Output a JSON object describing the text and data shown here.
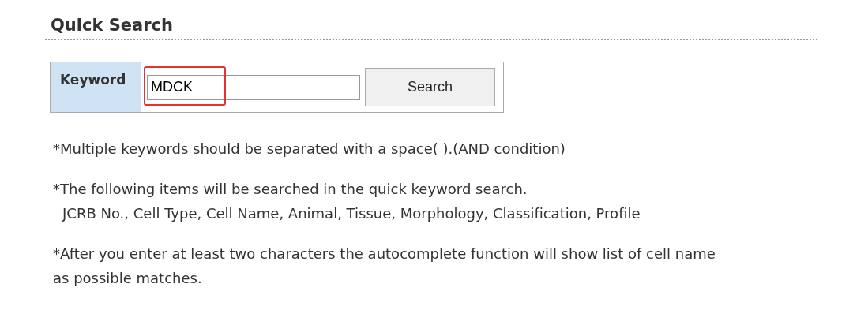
{
  "title": "Quick Search",
  "search": {
    "label": "Keyword",
    "value": "MDCK",
    "highlighted": true,
    "button": "Search"
  },
  "notes": [
    {
      "lines": [
        "*Multiple keywords should be separated with a space( ).(AND condition)"
      ]
    },
    {
      "lines": [
        "*The following items will be searched in the quick keyword search.",
        "JCRB No., Cell Type, Cell Name, Animal, Tissue, Morphology, Classification, Profile"
      ]
    },
    {
      "lines": [
        "*After you enter at least two characters the autocomplete function will show list of cell name",
        "as possible matches."
      ]
    }
  ]
}
